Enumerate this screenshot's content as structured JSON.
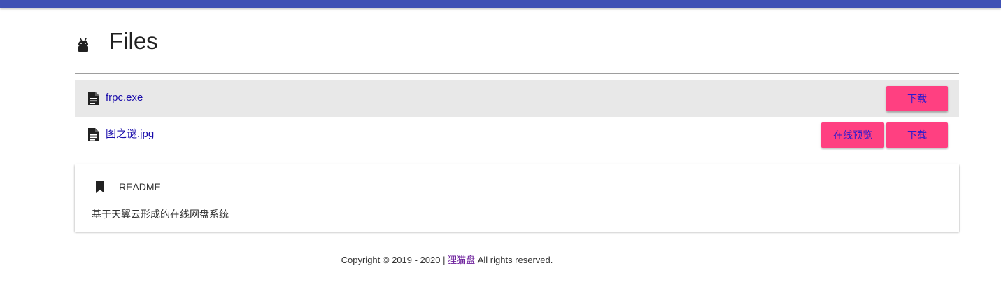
{
  "header": {
    "title": "Files",
    "logo_icon": "android-icon"
  },
  "files": [
    {
      "name": "frpc.exe",
      "icon": "file-icon",
      "download_label": "下载"
    },
    {
      "name": "图之谜.jpg",
      "icon": "file-icon",
      "preview_label": "在线预览",
      "stray_char": ";",
      "download_label": "下载"
    }
  ],
  "readme": {
    "icon": "bookmark-icon",
    "title": "README",
    "body": "基于天翼云形成的在线网盘系统"
  },
  "footer": {
    "prefix": "Copyright © 2019 - 2020 |",
    "brand": "狸猫盘",
    "suffix": "All rights reserved."
  },
  "colors": {
    "topbar": "#3f51b5",
    "button": "#ff4081",
    "link": "#1a0dab",
    "row_highlight": "#e8e8e8"
  }
}
